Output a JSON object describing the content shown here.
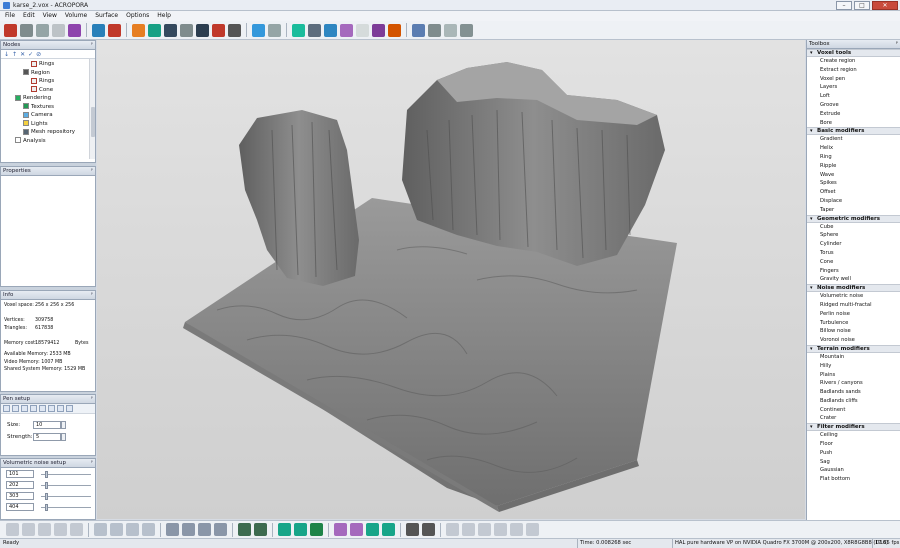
{
  "window": {
    "title": "karse_2.vox - ACROPORA",
    "minimize": "–",
    "maximize": "□",
    "close": "✕"
  },
  "menu": [
    "File",
    "Edit",
    "View",
    "Volume",
    "Surface",
    "Options",
    "Help"
  ],
  "nodes_panel": {
    "title": "Nodes",
    "pin": "ᵖ",
    "tools": [
      "↓",
      "↑",
      "✕",
      "✓",
      "⊘"
    ],
    "items": [
      {
        "label": "Rings",
        "indent": 3
      },
      {
        "label": "Region",
        "indent": 2
      },
      {
        "label": "Rings",
        "indent": 3
      },
      {
        "label": "Cone",
        "indent": 3
      },
      {
        "label": "Rendering",
        "indent": 1
      },
      {
        "label": "Textures",
        "indent": 2
      },
      {
        "label": "Camera",
        "indent": 2
      },
      {
        "label": "Lights",
        "indent": 2
      },
      {
        "label": "Mesh repository",
        "indent": 2
      },
      {
        "label": "Analysis",
        "indent": 1
      }
    ]
  },
  "properties_panel": {
    "title": "Properties",
    "pin": "ᵖ"
  },
  "info_panel": {
    "title": "Info",
    "pin": "ᵖ",
    "rows": [
      {
        "label": "Voxel space:",
        "value": "256 x 256 x 256",
        "unit": ""
      },
      {
        "label": "",
        "value": "",
        "unit": ""
      },
      {
        "label": "Vertices:",
        "value": "309758",
        "unit": ""
      },
      {
        "label": "Triangles:",
        "value": "617838",
        "unit": ""
      },
      {
        "label": "",
        "value": "",
        "unit": ""
      },
      {
        "label": "Memory cost:",
        "value": "18579412",
        "unit": "Bytes"
      },
      {
        "label": "",
        "value": "",
        "unit": ""
      },
      {
        "label": "Available Memory: 2533 MB",
        "value": "",
        "unit": ""
      },
      {
        "label": "Video Memory: 1007 MB",
        "value": "",
        "unit": ""
      },
      {
        "label": "Shared System Memory: 1529 MB",
        "value": "",
        "unit": ""
      }
    ]
  },
  "pen_panel": {
    "title": "Pen setup",
    "pin": "ᵖ",
    "size_label": "Size:",
    "size_value": "10",
    "strength_label": "Strength:",
    "strength_value": "5"
  },
  "noise_panel": {
    "title": "Volumetric noise setup",
    "pin": "ᵖ",
    "fields": [
      "101",
      "202",
      "303",
      "404"
    ]
  },
  "toolbox": {
    "title": "Toolbox",
    "pin": "ᵖ",
    "categories": [
      {
        "name": "Voxel tools",
        "items": [
          "Create region",
          "Extract region",
          "Voxel pen",
          "Layers",
          "Loft",
          "Groove",
          "Extrude",
          "Bore"
        ]
      },
      {
        "name": "Basic modifiers",
        "items": [
          "Gradient",
          "Helix",
          "Ring",
          "Ripple",
          "Wave",
          "Spikes",
          "Offset",
          "Displace",
          "Taper"
        ]
      },
      {
        "name": "Geometric modifiers",
        "items": [
          "Cube",
          "Sphere",
          "Cylinder",
          "Torus",
          "Cone",
          "Fingers",
          "Gravity well"
        ]
      },
      {
        "name": "Noise modifiers",
        "items": [
          "Volumetric noise",
          "Ridged multi-fractal",
          "Perlin noise",
          "Turbulence",
          "Billow noise",
          "Voronoi noise"
        ]
      },
      {
        "name": "Terrain modifiers",
        "items": [
          "Mountain",
          "Hilly",
          "Plains",
          "Rivers / canyons",
          "Badlands sands",
          "Badlands cliffs",
          "Continent",
          "Crater"
        ]
      },
      {
        "name": "Filter modifiers",
        "items": [
          "Ceiling",
          "Floor",
          "Push",
          "Sag",
          "Gaussian",
          "Flat bottom"
        ]
      }
    ]
  },
  "status": {
    "ready": "Ready",
    "time": "Time: 0.008268 sec",
    "renderer": "HAL pure hardware VP on NVIDIA Quadro FX 3700M @ 200x200, X8R8G8B8 (D16)",
    "fps": "17.85 fps"
  },
  "colors": {
    "accent": "#3a7bd5",
    "chrome": "#d6dbe3",
    "terrain": "#8a8a8a"
  }
}
